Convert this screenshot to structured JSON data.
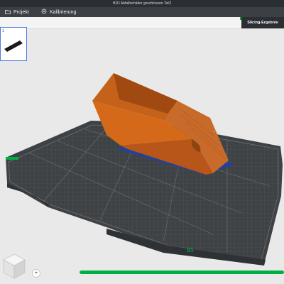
{
  "window": {
    "title": "H2D Abfallbehälter geschlossen Teil2"
  },
  "menu": {
    "project_label": "Projekt",
    "project_icon": "folder-icon",
    "calibration_label": "Kalibrierung",
    "calibration_icon": "target-icon"
  },
  "right_tab": {
    "label": "Slicing-Ergebnis"
  },
  "plate": {
    "number_label": "1"
  },
  "bed": {
    "marker": "01"
  },
  "progress": {
    "fraction": 1.0
  },
  "colors": {
    "accent_green": "#00ae42",
    "model_orange": "#d46a19",
    "bed_grid": "#4a4d50",
    "selection_blue": "#4b7be5"
  }
}
